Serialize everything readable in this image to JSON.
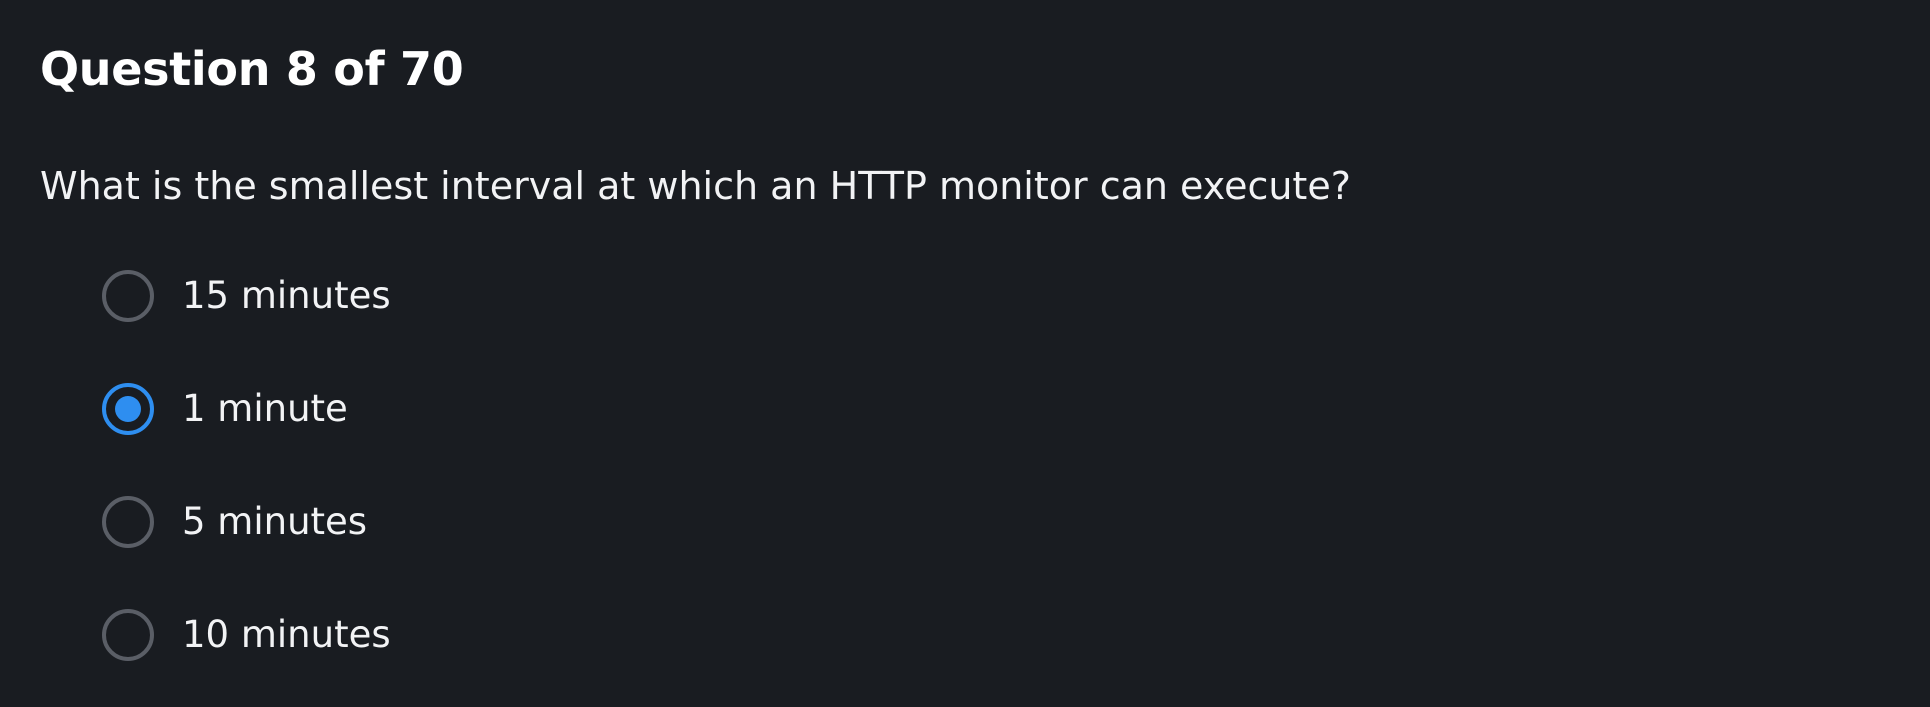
{
  "header": {
    "title": "Question 8 of 70"
  },
  "question": {
    "text": "What is the smallest interval at which an HTTP monitor can execute?"
  },
  "options": [
    {
      "label": "15 minutes",
      "selected": false
    },
    {
      "label": "1 minute",
      "selected": true
    },
    {
      "label": "5 minutes",
      "selected": false
    },
    {
      "label": "10 minutes",
      "selected": false
    }
  ],
  "colors": {
    "background": "#191c21",
    "accent": "#2e8ef0",
    "radio_border": "#5a5e66",
    "text": "#ffffff"
  }
}
